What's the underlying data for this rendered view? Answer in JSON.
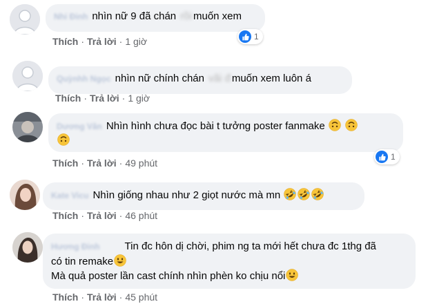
{
  "comments": [
    {
      "author": "Nhi Đinh",
      "text_before": "nhìn nữ 9 đã chán",
      "redacted": "rồi",
      "text_after": "muốn xem",
      "like_label": "Thích",
      "reply_label": "Trả lời",
      "time": "1 giờ",
      "reaction_count": "1"
    },
    {
      "author": "Quỳnhh Ngọc",
      "text_before": "nhìn nữ chính chán",
      "redacted": "vãi đ",
      "text_after": "muốn xem luôn á",
      "like_label": "Thích",
      "reply_label": "Trả lời",
      "time": "1 giờ"
    },
    {
      "author": "Dương Vân",
      "text": "Nhìn hình chưa đọc bài t tưởng poster fanmake",
      "emoji_name": "upside-down-face",
      "like_label": "Thích",
      "reply_label": "Trả lời",
      "time": "49 phút",
      "reaction_count": "1"
    },
    {
      "author": "Kate Vicu",
      "text": "Nhìn giống nhau như 2 giọt nước mà mn",
      "emoji_name": "rolling-on-floor-laughing",
      "like_label": "Thích",
      "reply_label": "Trả lời",
      "time": "46 phút"
    },
    {
      "author": "Hương Đinh",
      "line1": "Tin đc hôn dị chời, phim ng ta mới hết chưa đc 1thg đã",
      "line2": "có tin remake",
      "line3": "Mà quả poster lần cast chính nhìn phèn ko chịu nổi",
      "emoji_name": "grinning-face",
      "like_label": "Thích",
      "reply_label": "Trả lời",
      "time": "45 phút"
    }
  ],
  "colors": {
    "bubble": "#f0f2f5",
    "meta_text": "#65676b",
    "like_blue": "#1877f2",
    "emoji_yellow": "#f7c439"
  }
}
